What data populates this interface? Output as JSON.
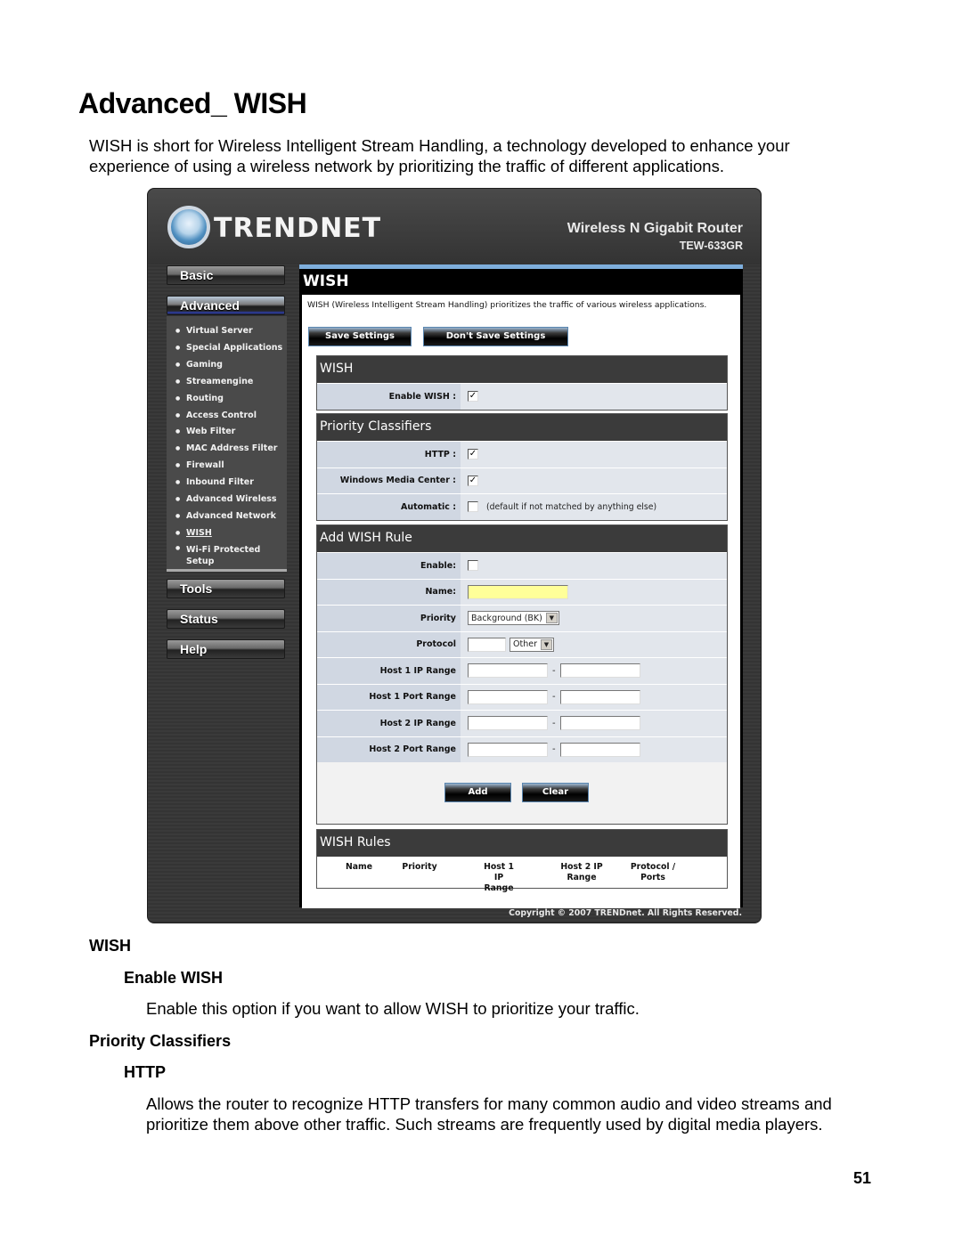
{
  "document": {
    "title": "Advanced_ WISH",
    "intro": "WISH is short for Wireless Intelligent Stream Handling, a technology developed to enhance your experience of using a wireless network by prioritizing the traffic of different applications.",
    "sections": [
      {
        "heading": "WISH"
      },
      {
        "subheading": "Enable WISH",
        "body": "Enable this option if you want to allow WISH to prioritize your traffic."
      },
      {
        "heading": "Priority Classifiers"
      },
      {
        "subheading": "HTTP",
        "body": "Allows the router to recognize HTTP transfers for many common audio and video streams and prioritize them above other traffic. Such streams are frequently used by digital media players."
      }
    ],
    "page_number": "51"
  },
  "router_ui": {
    "brand": "TRENDnet",
    "logo_icon": "trendnet-globe-logo-icon",
    "product_name": "Wireless N Gigabit Router",
    "product_model": "TEW-633GR",
    "sidebar": {
      "sections": [
        {
          "label": "Basic",
          "active": false
        },
        {
          "label": "Advanced",
          "active": true
        },
        {
          "label": "Tools",
          "active": false
        },
        {
          "label": "Status",
          "active": false
        },
        {
          "label": "Help",
          "active": false
        }
      ],
      "advanced_items": [
        {
          "label": "Virtual Server"
        },
        {
          "label": "Special Applications"
        },
        {
          "label": "Gaming"
        },
        {
          "label": "Streamengine"
        },
        {
          "label": "Routing"
        },
        {
          "label": "Access Control"
        },
        {
          "label": "Web Filter"
        },
        {
          "label": "MAC Address Filter"
        },
        {
          "label": "Firewall"
        },
        {
          "label": "Inbound Filter"
        },
        {
          "label": "Advanced Wireless"
        },
        {
          "label": "Advanced Network"
        },
        {
          "label": "WISH",
          "current": true
        },
        {
          "label": "Wi-Fi Protected Setup"
        }
      ]
    },
    "main": {
      "title": "WISH",
      "description": "WISH (Wireless Intelligent Stream Handling) prioritizes the traffic of various wireless applications.",
      "save_button": "Save Settings",
      "dont_save_button": "Don't Save Settings",
      "wish_panel": {
        "title": "WISH",
        "enable_label": "Enable WISH :",
        "enable_checked": true
      },
      "classifiers_panel": {
        "title": "Priority Classifiers",
        "rows": [
          {
            "label": "HTTP :",
            "checked": true,
            "note": ""
          },
          {
            "label": "Windows Media Center :",
            "checked": true,
            "note": ""
          },
          {
            "label": "Automatic :",
            "checked": false,
            "note": "(default if not matched by anything else)"
          }
        ]
      },
      "add_rule_panel": {
        "title": "Add WISH Rule",
        "enable_label": "Enable:",
        "enable_checked": false,
        "name_label": "Name:",
        "name_value": "",
        "priority_label": "Priority",
        "priority_value": "Background (BK)",
        "protocol_label": "Protocol",
        "protocol_number": "",
        "protocol_value": "Other",
        "range_rows": [
          {
            "label": "Host 1 IP Range",
            "from": "",
            "to": ""
          },
          {
            "label": "Host 1 Port Range",
            "from": "",
            "to": ""
          },
          {
            "label": "Host 2 IP Range",
            "from": "",
            "to": ""
          },
          {
            "label": "Host 2 Port Range",
            "from": "",
            "to": ""
          }
        ],
        "range_separator": "-",
        "add_button": "Add",
        "clear_button": "Clear"
      },
      "rules_panel": {
        "title": "WISH Rules",
        "columns": [
          "Name",
          "Priority",
          "Host 1 IP Range",
          "Host 2 IP Range",
          "Protocol / Ports"
        ]
      }
    },
    "copyright": "Copyright © 2007 TRENDnet. All Rights Reserved.",
    "colors": {
      "frame": "#3a3a3a",
      "panel_header": "#3b3b3b",
      "label_cell": "#d0d7e2",
      "value_cell": "#e2e6ec",
      "name_input": "#ffff99",
      "accent_blue": "#7eaedc"
    }
  }
}
